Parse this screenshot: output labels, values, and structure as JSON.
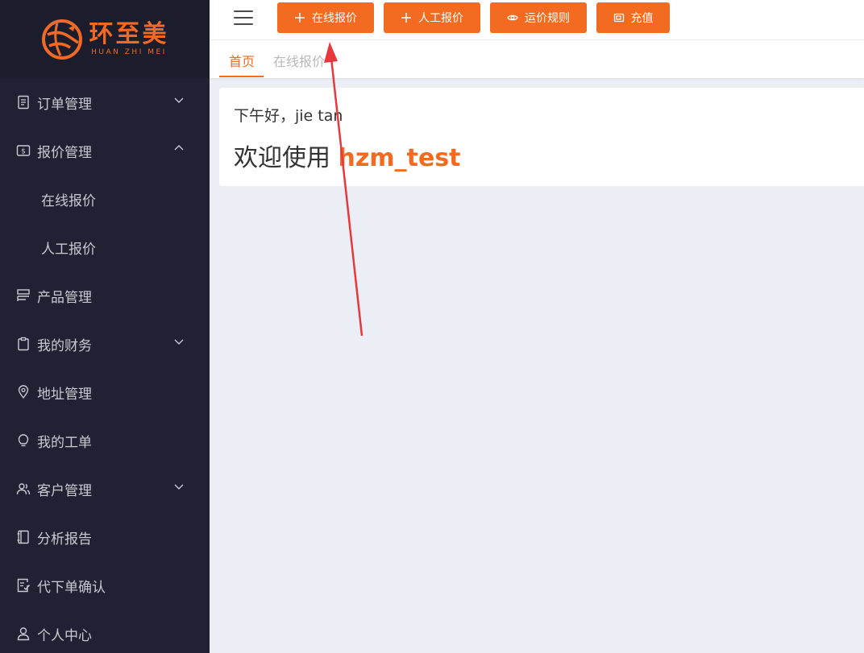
{
  "logo": {
    "cn": "环至美",
    "en": "HUAN ZHI MEI"
  },
  "sidebar": {
    "items": [
      {
        "label": "订单管理",
        "icon": "receipt-icon",
        "arrow": "down"
      },
      {
        "label": "报价管理",
        "icon": "dollar-card-icon",
        "arrow": "up"
      },
      {
        "label": "在线报价",
        "sub": true
      },
      {
        "label": "人工报价",
        "sub": true
      },
      {
        "label": "产品管理",
        "icon": "product-icon"
      },
      {
        "label": "我的财务",
        "icon": "clipboard-icon",
        "arrow": "down"
      },
      {
        "label": "地址管理",
        "icon": "location-icon"
      },
      {
        "label": "我的工单",
        "icon": "bulb-icon"
      },
      {
        "label": "客户管理",
        "icon": "users-icon",
        "arrow": "down"
      },
      {
        "label": "分析报告",
        "icon": "notebook-icon"
      },
      {
        "label": "代下单确认",
        "icon": "confirm-doc-icon"
      },
      {
        "label": "个人中心",
        "icon": "user-icon"
      }
    ]
  },
  "toolbar": {
    "online_quote": "在线报价",
    "manual_quote": "人工报价",
    "freight_rules": "运价规则",
    "recharge": "充值"
  },
  "tabs": [
    {
      "label": "首页",
      "active": true
    },
    {
      "label": "在线报价",
      "active": false
    }
  ],
  "welcome": {
    "greeting": "下午好，jie tan",
    "prefix": "欢迎使用",
    "username": "hzm_test"
  },
  "colors": {
    "accent": "#f26b21",
    "sidebar_bg": "#202234",
    "logo_bg": "#1b1d2c",
    "annotation_arrow": "#e8383d"
  }
}
